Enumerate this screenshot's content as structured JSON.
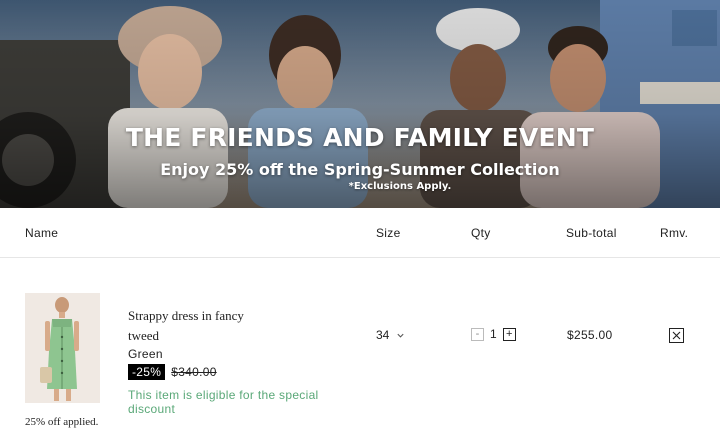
{
  "banner": {
    "title": "THE FRIENDS AND FAMILY EVENT",
    "subtitle": "Enjoy 25% off the Spring-Summer Collection",
    "note": "*Exclusions Apply."
  },
  "table": {
    "headers": {
      "name": "Name",
      "size": "Size",
      "qty": "Qty",
      "subtotal": "Sub-total",
      "remove": "Rmv."
    }
  },
  "item": {
    "name": "Strappy dress in fancy tweed",
    "color": "Green",
    "discount_badge": "-25%",
    "original_price": "$340.00",
    "eligibility": "This item is eligible for the special discount",
    "applied_note": "25% off applied.",
    "size": "34",
    "quantity": "1",
    "subtotal": "$255.00",
    "qty_minus": "-",
    "qty_plus": "+"
  },
  "colors": {
    "accent_green": "#5aa878",
    "badge_bg": "#000000"
  },
  "icons": {
    "size_dropdown": "chevron-down-icon",
    "remove": "close-icon"
  }
}
